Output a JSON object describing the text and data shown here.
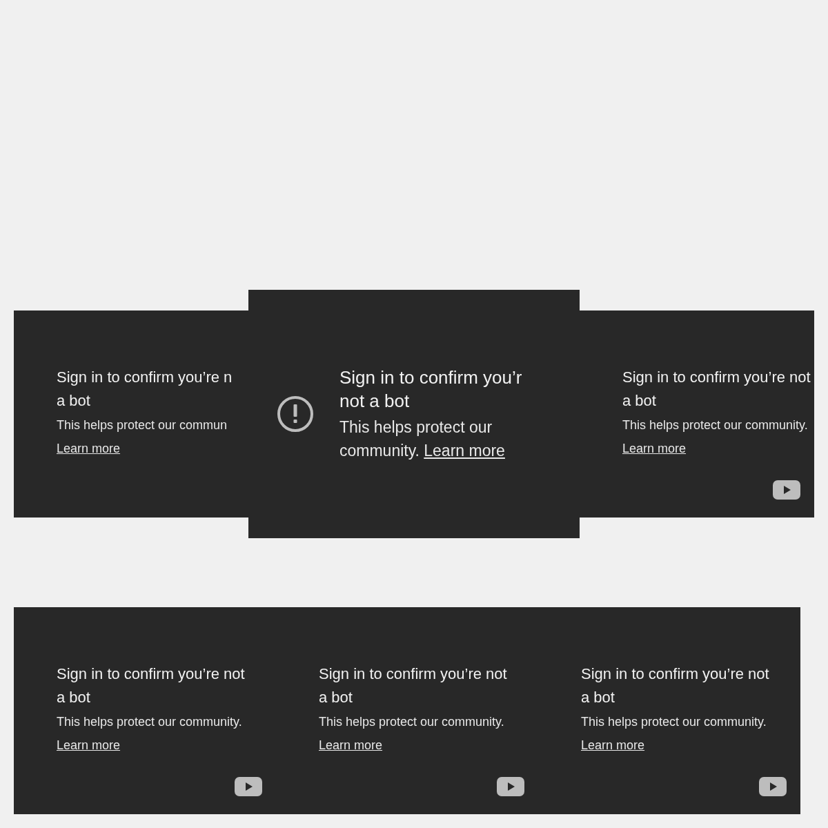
{
  "top_row": [
    {
      "kind": "compact",
      "title_lines": [
        "Sign in to confirm you’re n",
        "a bot"
      ],
      "body": "This helps protect our commun",
      "link": "Learn more"
    },
    {
      "kind": "expanded",
      "title_lines": [
        "Sign in to confirm you’r",
        "not a bot"
      ],
      "body": "This helps protect our community.",
      "link": "Learn more"
    },
    {
      "kind": "compact",
      "title_lines": [
        "Sign in to confirm you’re not",
        "a bot"
      ],
      "body": "This helps protect our community.",
      "link": "Learn more",
      "logo": true
    }
  ],
  "bottom_row": [
    {
      "kind": "compact",
      "title_lines": [
        "Sign in to confirm you’re not",
        "a bot"
      ],
      "body": "This helps protect our community.",
      "link": "Learn more",
      "logo": true
    },
    {
      "kind": "compact",
      "title_lines": [
        "Sign in to confirm you’re not",
        "a bot"
      ],
      "body": "This helps protect our community.",
      "link": "Learn more",
      "logo": true
    },
    {
      "kind": "compact",
      "title_lines": [
        "Sign in to confirm you’re not",
        "a bot"
      ],
      "body": "This helps protect our community.",
      "link": "Learn more",
      "logo": true
    }
  ]
}
